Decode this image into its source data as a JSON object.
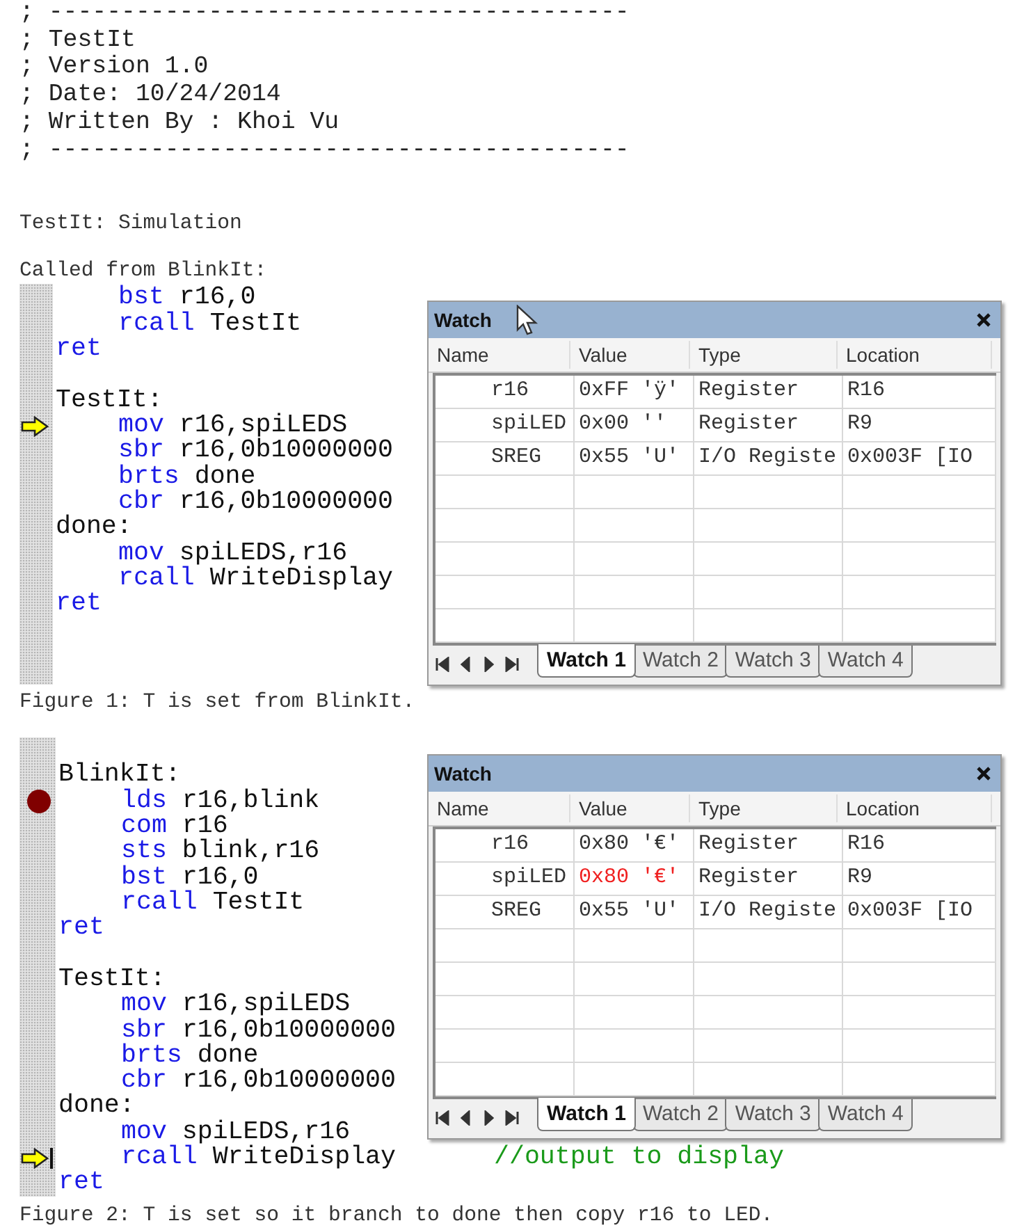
{
  "header": {
    "lines": [
      "; ----------------------------------------",
      "; TestIt",
      "; Version 1.0",
      "; Date: 10/24/2014",
      "; Written By : Khoi Vu",
      "; ----------------------------------------"
    ]
  },
  "subtitle": "TestIt: Simulation",
  "intro": "Called from BlinkIt:",
  "figures": [
    {
      "code": [
        {
          "kind": "instr",
          "op": "bst",
          "args": "r16,0",
          "current": false,
          "breakpoint": false
        },
        {
          "kind": "instr",
          "op": "rcall",
          "args": "TestIt",
          "current": false,
          "breakpoint": false
        },
        {
          "kind": "ret",
          "op": "ret",
          "current": false,
          "breakpoint": false
        },
        {
          "kind": "blank"
        },
        {
          "kind": "label",
          "text": "TestIt:",
          "current": false,
          "breakpoint": false
        },
        {
          "kind": "instr",
          "op": "mov",
          "args": "r16,spiLEDS",
          "current": true,
          "breakpoint": false
        },
        {
          "kind": "instr",
          "op": "sbr",
          "args": "r16,0b10000000",
          "current": false,
          "breakpoint": false
        },
        {
          "kind": "instr",
          "op": "brts",
          "args": "done",
          "current": false,
          "breakpoint": false
        },
        {
          "kind": "instr",
          "op": "cbr",
          "args": "r16,0b10000000",
          "current": false,
          "breakpoint": false
        },
        {
          "kind": "label",
          "text": "done:",
          "current": false,
          "breakpoint": false
        },
        {
          "kind": "instr",
          "op": "mov",
          "args": "spiLEDS,r16",
          "current": false,
          "breakpoint": false
        },
        {
          "kind": "instr",
          "op": "rcall",
          "args": "WriteDisplay",
          "current": false,
          "breakpoint": false
        },
        {
          "kind": "ret",
          "op": "ret",
          "current": false,
          "breakpoint": false
        }
      ],
      "watch": {
        "title": "Watch",
        "pointer": true,
        "columns": [
          "Name",
          "Value",
          "Type",
          "Location"
        ],
        "rows": [
          {
            "name": "r16",
            "value": "0xFF 'ÿ'",
            "type": "Register",
            "location": "R16",
            "changed": false
          },
          {
            "name": "spiLED",
            "value": "0x00 ''",
            "type": "Register",
            "location": "R9",
            "changed": false
          },
          {
            "name": "SREG",
            "value": "0x55 'U'",
            "type": "I/O Registe",
            "location": "0x003F [IO",
            "changed": false
          }
        ],
        "tabs": [
          {
            "label": "Watch 1",
            "selected": true
          },
          {
            "label": "Watch 2",
            "selected": false
          },
          {
            "label": "Watch 3",
            "selected": false
          },
          {
            "label": "Watch 4",
            "selected": false
          }
        ]
      },
      "caption": "Figure 1: T is set from BlinkIt."
    },
    {
      "code": [
        {
          "kind": "label",
          "text": "BlinkIt:",
          "current": false,
          "breakpoint": false
        },
        {
          "kind": "instr",
          "op": "lds",
          "args": "r16,blink",
          "current": false,
          "breakpoint": true
        },
        {
          "kind": "instr",
          "op": "com",
          "args": "r16",
          "current": false,
          "breakpoint": false
        },
        {
          "kind": "instr",
          "op": "sts",
          "args": "blink,r16",
          "current": false,
          "breakpoint": false
        },
        {
          "kind": "instr",
          "op": "bst",
          "args": "r16,0",
          "current": false,
          "breakpoint": false
        },
        {
          "kind": "instr",
          "op": "rcall",
          "args": "TestIt",
          "current": false,
          "breakpoint": false
        },
        {
          "kind": "ret",
          "op": "ret",
          "current": false,
          "breakpoint": false
        },
        {
          "kind": "blank"
        },
        {
          "kind": "label",
          "text": "TestIt:",
          "current": false,
          "breakpoint": false
        },
        {
          "kind": "instr",
          "op": "mov",
          "args": "r16,spiLEDS",
          "current": false,
          "breakpoint": false
        },
        {
          "kind": "instr",
          "op": "sbr",
          "args": "r16,0b10000000",
          "current": false,
          "breakpoint": false
        },
        {
          "kind": "instr",
          "op": "brts",
          "args": "done",
          "current": false,
          "breakpoint": false
        },
        {
          "kind": "instr",
          "op": "cbr",
          "args": "r16,0b10000000",
          "current": false,
          "breakpoint": false
        },
        {
          "kind": "label",
          "text": "done:",
          "current": false,
          "breakpoint": false
        },
        {
          "kind": "instr",
          "op": "mov",
          "args": "spiLEDS,r16",
          "current": false,
          "breakpoint": false
        },
        {
          "kind": "instr",
          "op": "rcall",
          "args": "WriteDisplay",
          "current": true,
          "breakpoint": false,
          "comment": "//output to display"
        },
        {
          "kind": "ret",
          "op": "ret",
          "current": false,
          "breakpoint": false
        }
      ],
      "watch": {
        "title": "Watch",
        "pointer": false,
        "columns": [
          "Name",
          "Value",
          "Type",
          "Location"
        ],
        "rows": [
          {
            "name": "r16",
            "value": "0x80 '€'",
            "type": "Register",
            "location": "R16",
            "changed": false
          },
          {
            "name": "spiLED",
            "value": "0x80 '€'",
            "type": "Register",
            "location": "R9",
            "changed": true
          },
          {
            "name": "SREG",
            "value": "0x55 'U'",
            "type": "I/O Registe",
            "location": "0x003F [IO",
            "changed": false
          }
        ],
        "tabs": [
          {
            "label": "Watch 1",
            "selected": true
          },
          {
            "label": "Watch 2",
            "selected": false
          },
          {
            "label": "Watch 3",
            "selected": false
          },
          {
            "label": "Watch 4",
            "selected": false
          }
        ]
      },
      "caption": "Figure 2: T is set so it branch to done then copy r16 to LED."
    }
  ]
}
